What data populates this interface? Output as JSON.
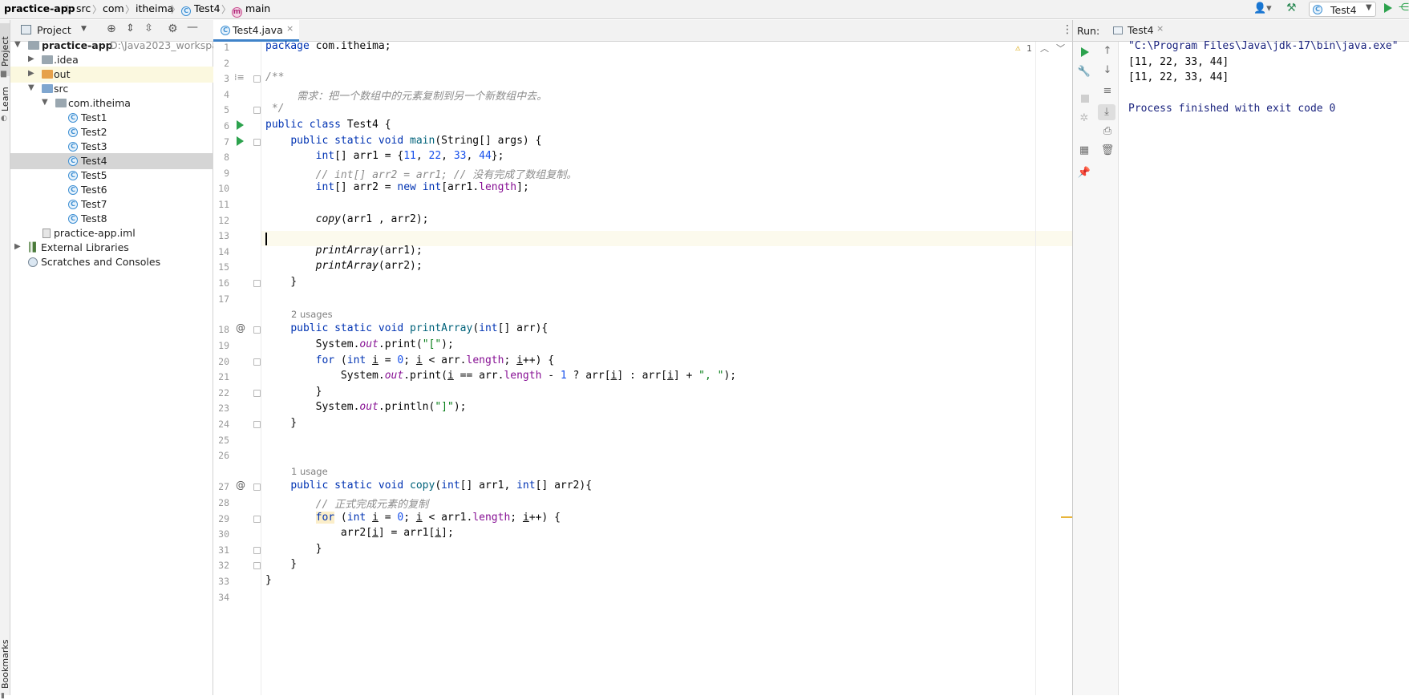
{
  "breadcrumb": {
    "project": "practice-app",
    "src": "src",
    "com": "com",
    "itheima": "itheima",
    "class": "Test4",
    "method": "main"
  },
  "toolbar": {
    "run_config": "Test4"
  },
  "left_strip": {
    "project": "Project",
    "learn": "Learn",
    "bookmarks": "Bookmarks"
  },
  "project_panel": {
    "title": "Project",
    "tree": [
      {
        "label": "practice-app",
        "path": "D:\\Java2023_workspa"
      },
      {
        "label": ".idea"
      },
      {
        "label": "out"
      },
      {
        "label": "src"
      },
      {
        "label": "com.itheima"
      },
      {
        "label": "Test1"
      },
      {
        "label": "Test2"
      },
      {
        "label": "Test3"
      },
      {
        "label": "Test4"
      },
      {
        "label": "Test5"
      },
      {
        "label": "Test6"
      },
      {
        "label": "Test7"
      },
      {
        "label": "Test8"
      },
      {
        "label": "practice-app.iml"
      },
      {
        "label": "External Libraries"
      },
      {
        "label": "Scratches and Consoles"
      }
    ]
  },
  "editor": {
    "tab_label": "Test4.java",
    "warning_count": "1",
    "line_numbers": [
      "1",
      "2",
      "3",
      "4",
      "5",
      "6",
      "7",
      "8",
      "9",
      "10",
      "11",
      "12",
      "13",
      "14",
      "15",
      "16",
      "17",
      "18",
      "19",
      "20",
      "21",
      "22",
      "23",
      "24",
      "25",
      "26",
      "27",
      "28",
      "29",
      "30",
      "31",
      "32",
      "33",
      "34"
    ],
    "usage_hints": [
      "2 usages",
      "1 usage"
    ]
  },
  "run_panel": {
    "label": "Run:",
    "tab_label": "Test4",
    "output": [
      "\"C:\\Program Files\\Java\\jdk-17\\bin\\java.exe\"",
      "[11, 22, 33, 44]",
      "[11, 22, 33, 44]",
      "",
      "Process finished with exit code 0"
    ]
  }
}
